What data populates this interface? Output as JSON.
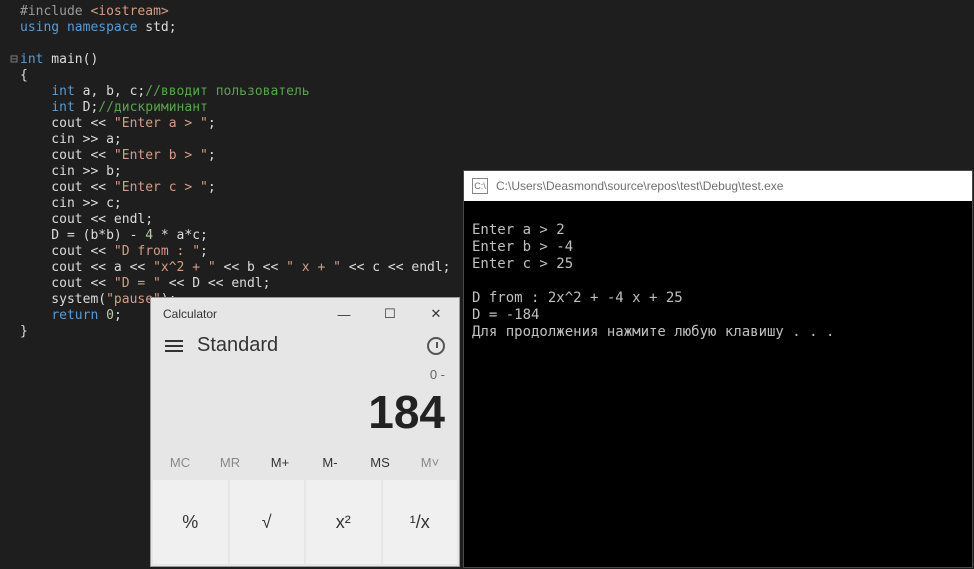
{
  "code": {
    "l1_pp": "#include ",
    "l1_inc": "<iostream>",
    "l2_kw1": "using ",
    "l2_kw2": "namespace",
    "l2_rest": " std;",
    "l3": "",
    "l4_kw": "int",
    "l4_rest": " main()",
    "l5": "{",
    "l6_ind": "    ",
    "l6_kw": "int",
    "l6_rest": " a, b, c;",
    "l6_cmt": "//вводит пользователь",
    "l7_kw": "int",
    "l7_rest": " D;",
    "l7_cmt": "//дискриминант",
    "l8a": "    cout << ",
    "l8s": "\"Enter a > \"",
    "l8b": ";",
    "l9": "    cin >> a;",
    "l10a": "    cout << ",
    "l10s": "\"Enter b > \"",
    "l10b": ";",
    "l11": "    cin >> b;",
    "l12a": "    cout << ",
    "l12s": "\"Enter c > \"",
    "l12b": ";",
    "l13": "    cin >> c;",
    "l14": "    cout << endl;",
    "l15a": "    D = (b*b) - ",
    "l15n": "4",
    "l15b": " * a*c;",
    "l16a": "    cout << ",
    "l16s": "\"D from : \"",
    "l16b": ";",
    "l17a": "    cout << a << ",
    "l17s1": "\"x^2 + \"",
    "l17b": " << b << ",
    "l17s2": "\" x + \"",
    "l17c": " << c << endl;",
    "l18a": "    cout << ",
    "l18s": "\"D = \"",
    "l18b": " << D << endl;",
    "l19a": "    system(",
    "l19s": "\"pause\"",
    "l19b": ");",
    "l20a": "    ",
    "l20kw": "return",
    "l20b": " ",
    "l20n": "0",
    "l20c": ";",
    "l21": "}"
  },
  "console": {
    "title": "C:\\Users\\Deasmond\\source\\repos\\test\\Debug\\test.exe",
    "line1": "Enter a > 2",
    "line2": "Enter b > -4",
    "line3": "Enter c > 25",
    "line4": "",
    "line5": "D from : 2x^2 + -4 x + 25",
    "line6": "D = -184",
    "line7": "Для продолжения нажмите любую клавишу . . ."
  },
  "calc": {
    "title": "Calculator",
    "mode": "Standard",
    "display_top": "0 -",
    "display_main": "184",
    "mem": {
      "mc": "MC",
      "mr": "MR",
      "mplus": "M+",
      "mminus": "M-",
      "ms": "MS",
      "mlist": "M˅"
    },
    "btn": {
      "pct": "%",
      "sqrt": "√",
      "sq": "x²",
      "recip": "¹/x"
    }
  }
}
